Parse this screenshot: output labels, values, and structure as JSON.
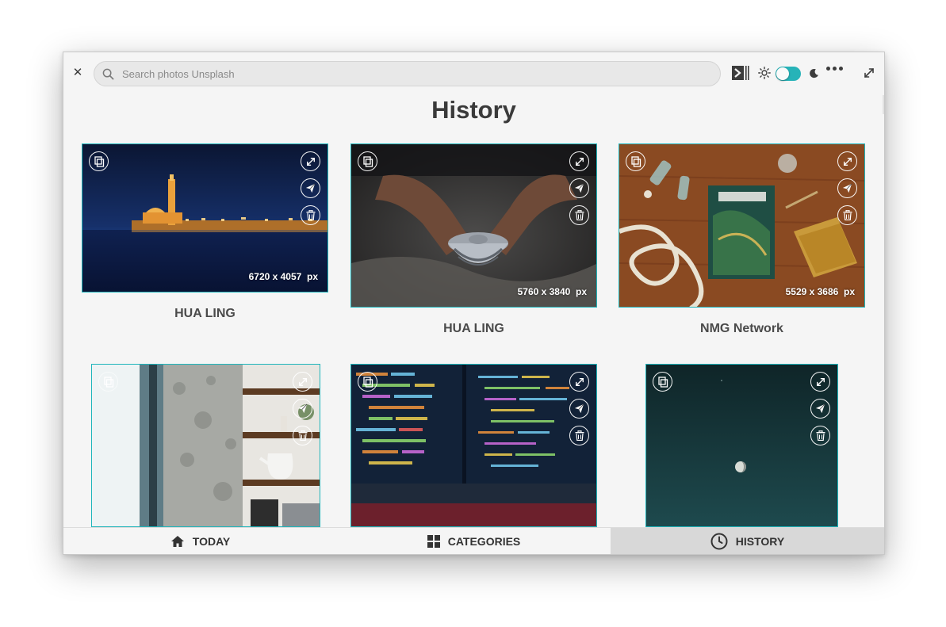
{
  "search": {
    "placeholder": "Search photos Unsplash"
  },
  "page": {
    "title": "History"
  },
  "header_icons": [
    "close-icon",
    "search-icon",
    "slideshow-icon",
    "sun-icon",
    "theme-toggle",
    "moon-icon",
    "more-icon",
    "fullscreen-icon"
  ],
  "theme": {
    "dark_mode": true,
    "accent": "#1fb5bb"
  },
  "photos": [
    {
      "dims": "6720 x 4057  px",
      "author": "HUA LING"
    },
    {
      "dims": "5760 x 3840  px",
      "author": "HUA LING"
    },
    {
      "dims": "5529 x 3686  px",
      "author": "NMG Network"
    },
    {
      "dims": "",
      "author": ""
    },
    {
      "dims": "",
      "author": ""
    },
    {
      "dims": "",
      "author": ""
    }
  ],
  "card_icons": [
    "copy-icon",
    "expand-icon",
    "send-icon",
    "trash-icon"
  ],
  "nav": {
    "today": "TODAY",
    "categories": "CATEGORIES",
    "history": "HISTORY",
    "active": "history"
  }
}
